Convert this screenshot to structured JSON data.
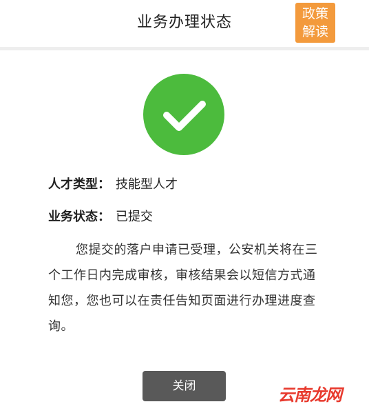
{
  "header": {
    "title": "业务办理状态",
    "policy_button": {
      "line1": "政策",
      "line2": "解读"
    }
  },
  "status_icon": "checkmark-icon",
  "info": {
    "type_label": "人才类型：",
    "type_value": "技能型人才",
    "status_label": "业务状态：",
    "status_value": "已提交"
  },
  "notice": "您提交的落户申请已受理，公安机关将在三个工作日内完成审核，审核结果会以短信方式通知您，您也可以在责任告知页面进行办理进度查询。",
  "close_button_label": "关闭",
  "watermark": "云南龙网",
  "colors": {
    "success": "#4cbb3d",
    "policy_button": "#f39a3c",
    "close_button": "#595959",
    "watermark": "#e83a2e"
  }
}
